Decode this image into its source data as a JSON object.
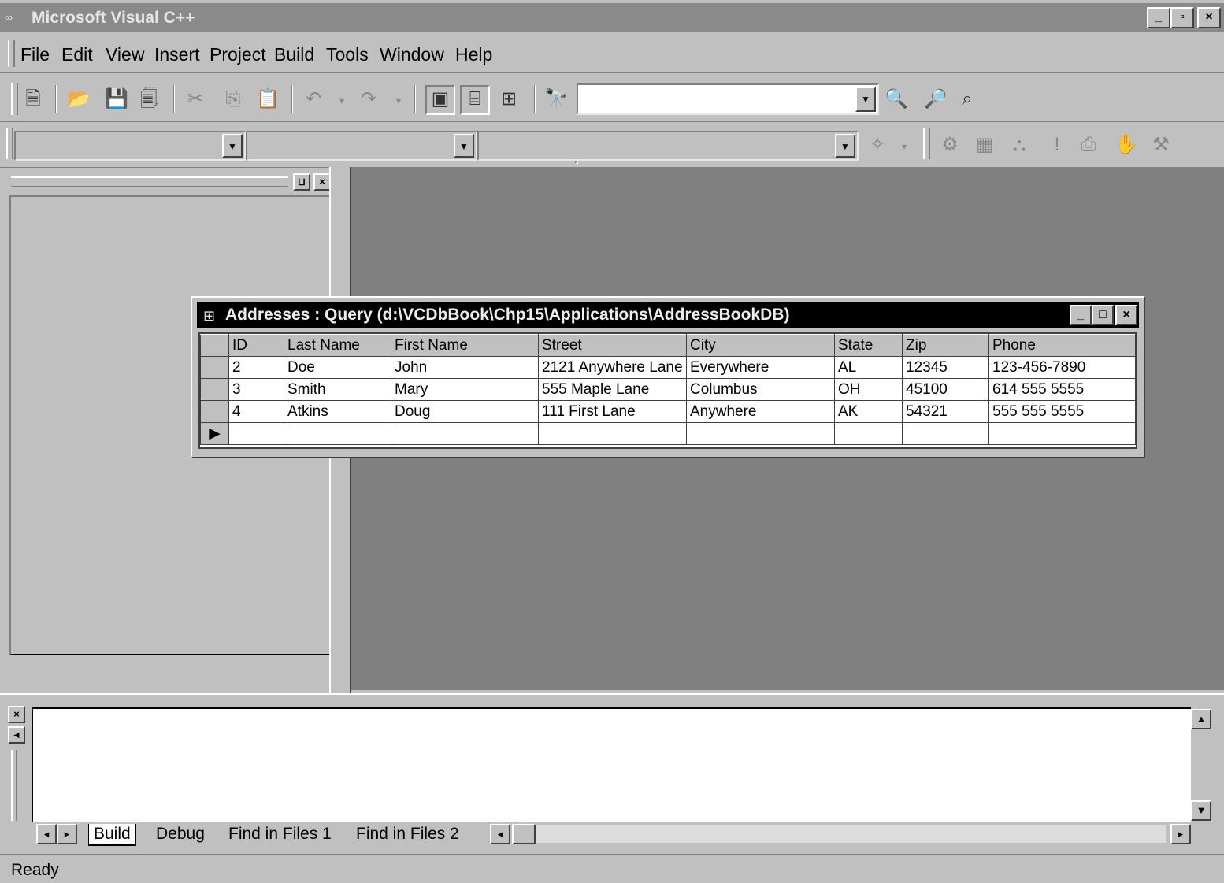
{
  "window": {
    "title": "Microsoft Visual C++",
    "min": "_",
    "max": "▫",
    "close": "×"
  },
  "menu": {
    "items": [
      "File",
      "Edit",
      "View",
      "Insert",
      "Project",
      "Build",
      "Tools",
      "Window",
      "Help"
    ]
  },
  "toolbar": {
    "find_value": "",
    "wizard_combo1": "",
    "wizard_combo2": "",
    "wizard_combo3": ""
  },
  "query_window": {
    "title": "Addresses : Query (d:\\VCDbBook\\Chp15\\Applications\\AddressBookDB)",
    "columns": [
      "ID",
      "Last Name",
      "First Name",
      "Street",
      "City",
      "State",
      "Zip",
      "Phone"
    ],
    "rows": [
      [
        "2",
        "Doe",
        "John",
        "2121 Anywhere Lane",
        "Everywhere",
        "AL",
        "12345",
        "123-456-7890"
      ],
      [
        "3",
        "Smith",
        "Mary",
        "555 Maple Lane",
        "Columbus",
        "OH",
        "45100",
        "614 555 5555"
      ],
      [
        "4",
        "Atkins",
        "Doug",
        "111 First Lane",
        "Anywhere",
        "AK",
        "54321",
        "555 555 5555"
      ]
    ],
    "new_row_marker": "▶"
  },
  "output": {
    "tabs": [
      "Build",
      "Debug",
      "Find in Files 1",
      "Find in Files 2"
    ],
    "active_tab": "Build"
  },
  "status": {
    "text": "Ready"
  }
}
